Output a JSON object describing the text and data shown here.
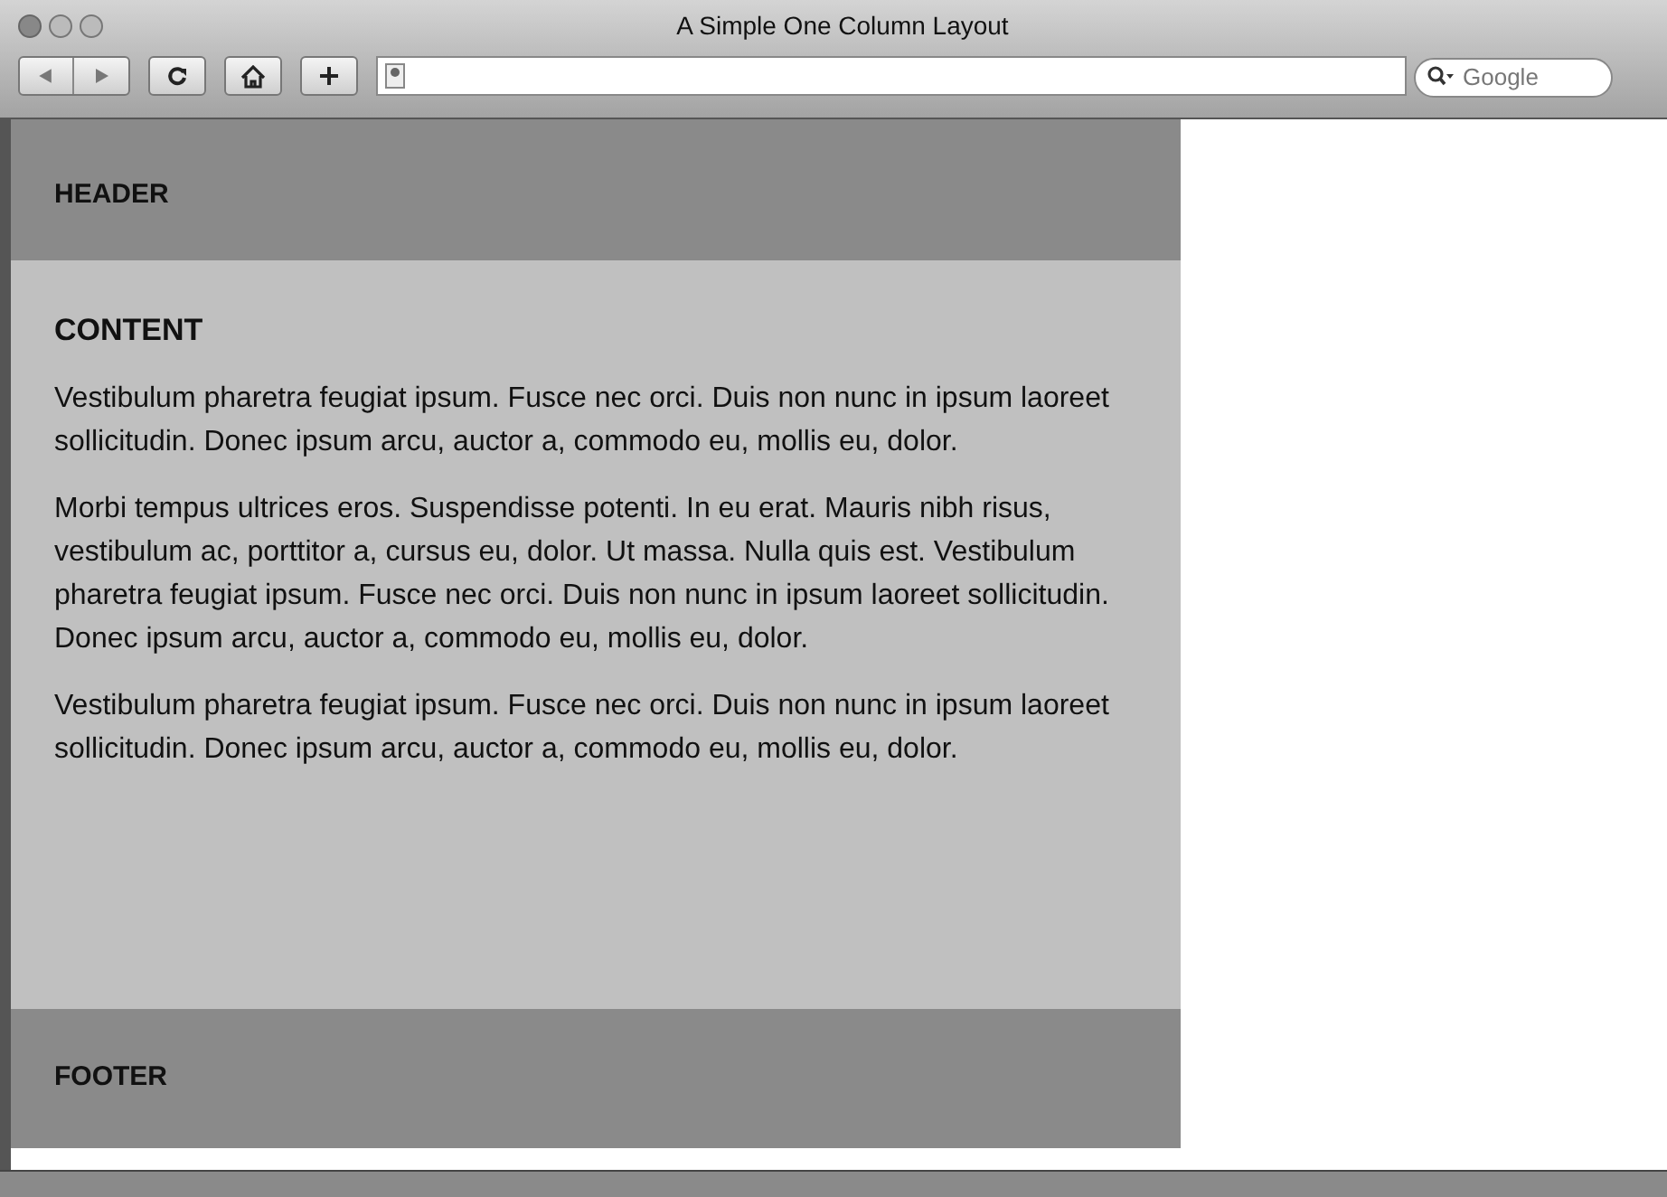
{
  "window": {
    "title": "A Simple One Column Layout"
  },
  "toolbar": {
    "search": {
      "placeholder": "Google"
    }
  },
  "page": {
    "header": "HEADER",
    "content": {
      "heading": "CONTENT",
      "paragraphs": [
        "Vestibulum pharetra feugiat ipsum. Fusce nec orci. Duis non nunc in ipsum laoreet sollicitudin. Donec ipsum arcu, auctor a, commodo eu, mollis eu, dolor.",
        "Morbi tempus ultrices eros. Suspendisse potenti. In eu erat. Mauris nibh risus, vestibulum ac, porttitor a, cursus eu, dolor. Ut massa. Nulla quis est. Vestibulum pharetra feugiat ipsum. Fusce nec orci. Duis non nunc in ipsum laoreet sollicitudin. Donec ipsum arcu, auctor a, commodo eu, mollis eu, dolor.",
        "Vestibulum pharetra feugiat ipsum. Fusce nec orci. Duis non nunc in ipsum laoreet sollicitudin. Donec ipsum arcu, auctor a, commodo eu, mollis eu, dolor."
      ]
    },
    "footer": "FOOTER"
  }
}
